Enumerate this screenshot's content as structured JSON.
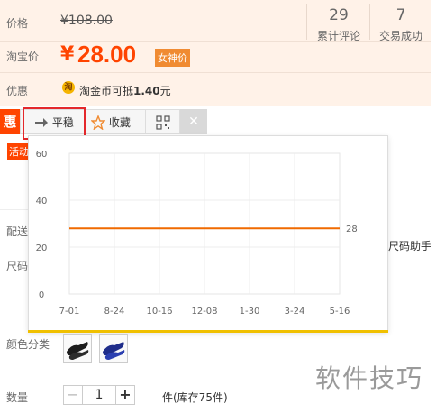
{
  "price": {
    "label_price": "价格",
    "original": "¥108.00",
    "label_taobao": "淘宝价",
    "currency": "¥",
    "amount": "28.00",
    "badge": "女神价",
    "label_promo": "优惠",
    "coin_icon_text": "淘",
    "promo_text_prefix": "淘金币可抵",
    "promo_value": "1.40",
    "promo_unit": "元"
  },
  "stats": [
    {
      "value": "29",
      "label": "累计评论"
    },
    {
      "value": "7",
      "label": "交易成功"
    }
  ],
  "toolbar": {
    "side_tag": "惠",
    "trend_label": "平稳",
    "fav_label": "收藏",
    "close_glyph": "✕"
  },
  "left_labels": {
    "activity_tag": "活动",
    "delivery": "配送",
    "size": "尺码",
    "color": "颜色分类",
    "quantity": "数量"
  },
  "right_partial": "尺码助手",
  "quantity": {
    "minus": "−",
    "value": "1",
    "plus": "+",
    "stock_text": "件(库存75件)"
  },
  "watermark": "软件技巧",
  "colors": {
    "accent": "#ff4400",
    "badge": "#f08b32",
    "line": "#f06a00",
    "highlight": "#e4282b"
  },
  "chart_data": {
    "type": "line",
    "x": [
      "7-01",
      "8-24",
      "10-16",
      "12-08",
      "1-30",
      "3-24",
      "5-16"
    ],
    "series": [
      {
        "values": [
          28,
          28,
          28,
          28,
          28,
          28,
          28
        ]
      }
    ],
    "end_label": "28",
    "y_ticks": [
      "0",
      "20",
      "40",
      "60"
    ],
    "ylim": [
      0,
      60
    ],
    "grid": true
  }
}
